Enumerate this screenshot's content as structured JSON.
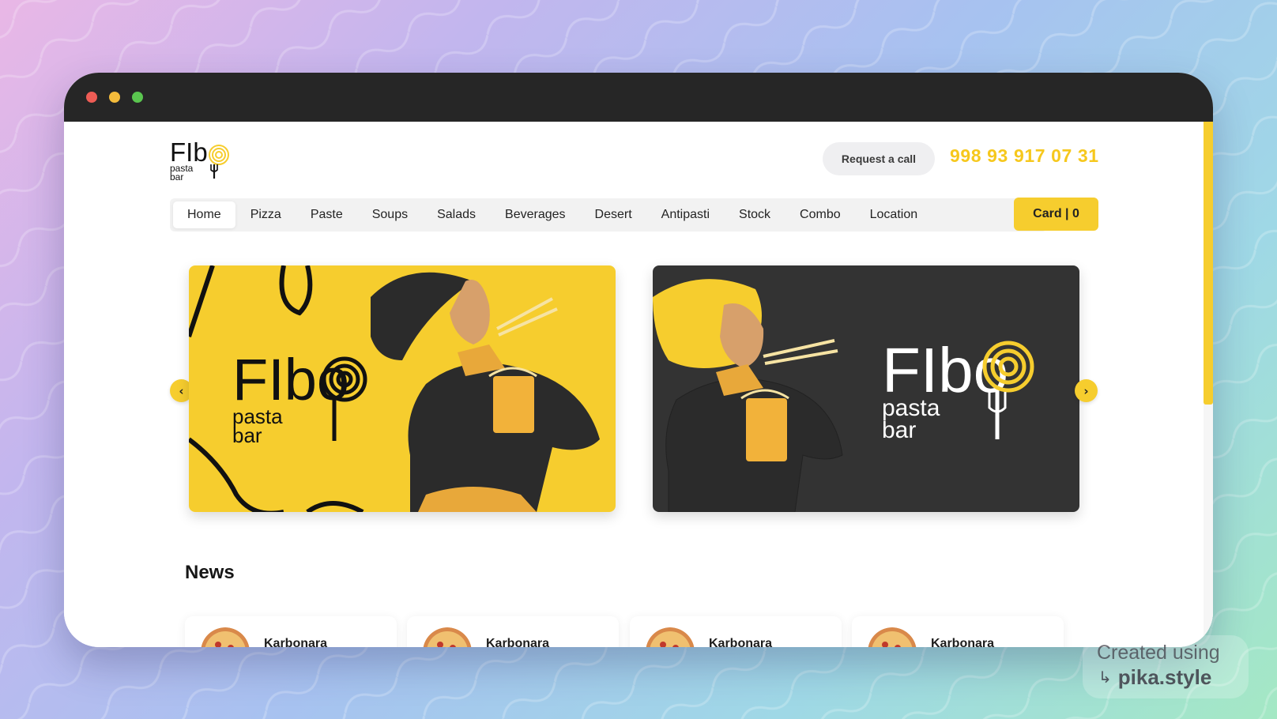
{
  "header": {
    "logo_text": "FIBO pasta bar",
    "request_button": "Request a call",
    "phone": "998 93 917 07 31"
  },
  "nav": {
    "items": [
      {
        "label": "Home",
        "active": true
      },
      {
        "label": "Pizza"
      },
      {
        "label": "Paste"
      },
      {
        "label": "Soups"
      },
      {
        "label": "Salads"
      },
      {
        "label": "Beverages"
      },
      {
        "label": "Desert"
      },
      {
        "label": "Antipasti"
      },
      {
        "label": "Stock"
      },
      {
        "label": "Combo"
      },
      {
        "label": "Location"
      }
    ],
    "cart_label": "Card | 0"
  },
  "carousel": {
    "slides": [
      {
        "brand": "FIbo",
        "sub1": "pasta",
        "sub2": "bar",
        "theme": "yellow"
      },
      {
        "brand": "FIbo",
        "sub1": "pasta",
        "sub2": "bar",
        "theme": "dark"
      }
    ],
    "prev_icon": "chevron-left-icon",
    "next_icon": "chevron-right-icon"
  },
  "news": {
    "title": "News",
    "items": [
      {
        "name": "Karbonara"
      },
      {
        "name": "Karbonara"
      },
      {
        "name": "Karbonara"
      },
      {
        "name": "Karbonara"
      }
    ]
  },
  "watermark": {
    "line1": "Created using",
    "line2": "pika.style"
  },
  "colors": {
    "accent": "#f6cd2e",
    "phone": "#f6c81d",
    "titlebar": "#262626",
    "dark_slide": "#333333"
  }
}
